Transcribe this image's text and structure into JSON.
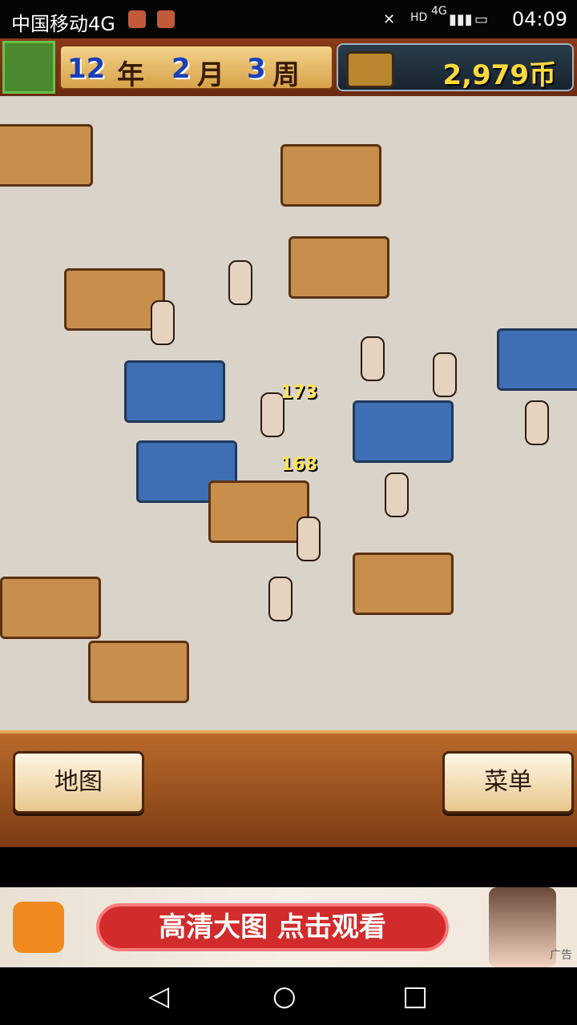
{
  "statusbar": {
    "carrier": "中国移动4G",
    "network": "4G",
    "hd": "HD",
    "time": "04:09"
  },
  "hud": {
    "year_value": "12",
    "year_unit": "年",
    "month_value": "2",
    "month_unit": "月",
    "week_value": "3",
    "week_unit": "周",
    "money": "2,979币"
  },
  "map": {
    "coin_labels": [
      {
        "value": "173"
      },
      {
        "value": "168"
      }
    ]
  },
  "panel": {
    "map_button": "地图",
    "menu_button": "菜单"
  },
  "ad": {
    "banner_text": "高清大图 点击观看",
    "ad_tag": "广告"
  }
}
